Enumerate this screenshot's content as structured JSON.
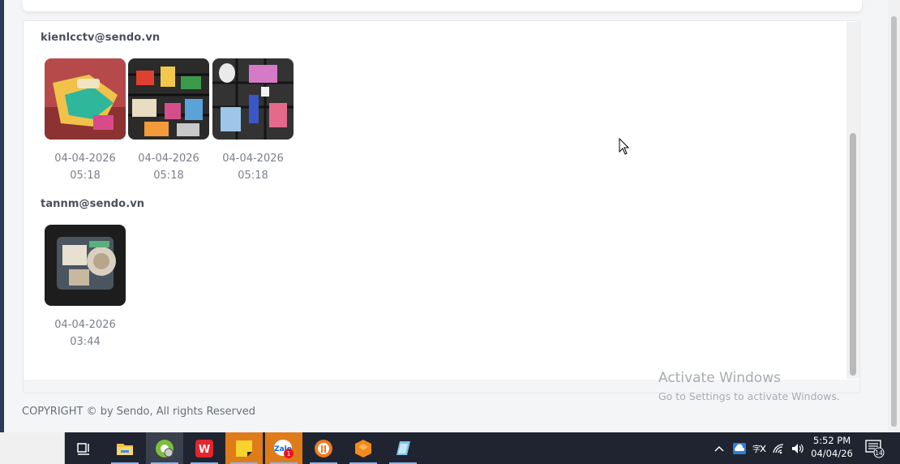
{
  "sections": [
    {
      "email": "kienlcctv@sendo.vn",
      "photos": [
        {
          "date": "04-04-2026",
          "time": "05:18"
        },
        {
          "date": "04-04-2026",
          "time": "05:18"
        },
        {
          "date": "04-04-2026",
          "time": "05:18"
        }
      ]
    },
    {
      "email": "tannm@sendo.vn",
      "photos": [
        {
          "date": "04-04-2026",
          "time": "03:44"
        }
      ]
    }
  ],
  "footer": {
    "copyright": "COPYRIGHT © by Sendo, All rights Reserved"
  },
  "watermark": {
    "title": "Activate Windows",
    "subtitle": "Go to Settings to activate Windows."
  },
  "taskbar": {
    "apps": [
      "task-view",
      "file-explorer",
      "chrome-profile",
      "wps-office",
      "sticky-notes",
      "zalo",
      "ultraviewer",
      "sublime",
      "notes"
    ],
    "zalo_badge": "1",
    "clock_time": "5:52 PM",
    "clock_date": "04/04/26",
    "notification_count": "14"
  },
  "colors": {
    "sidebar": "#2b3a55",
    "taskbar": "#1f2430",
    "badge": "#e81123"
  }
}
